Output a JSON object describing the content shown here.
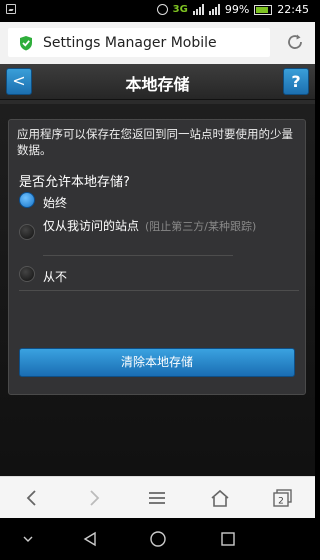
{
  "status_bar": {
    "network": "3G",
    "battery": "99%",
    "time": "22:45"
  },
  "browser": {
    "url_title": "Settings Manager Mobile"
  },
  "header": {
    "back_label": "<",
    "title": "本地存储",
    "help_label": "?"
  },
  "panel": {
    "description": "应用程序可以保存在您返回到同一站点时要使用的少量数据。",
    "question": "是否允许本地存储?",
    "options": [
      {
        "label": "始终",
        "hint": "",
        "selected": true
      },
      {
        "label": "仅从我访问的站点",
        "hint": "(阻止第三方/某种跟踪)",
        "selected": false
      },
      {
        "label": "从不",
        "hint": "",
        "selected": false
      }
    ],
    "clear_button": "清除本地存储"
  },
  "browser_nav": {
    "tab_count": "2"
  },
  "colors": {
    "accent": "#1f7fc8",
    "shield": "#2fae3b",
    "network": "#7ec322"
  }
}
